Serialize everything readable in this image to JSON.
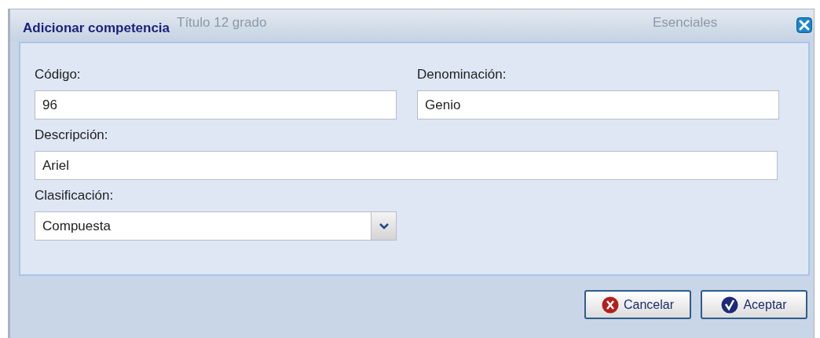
{
  "background_texts": [
    "Título 12 grado",
    "Esenciales"
  ],
  "dialog": {
    "title": "Adicionar competencia"
  },
  "fields": [
    {
      "kind": "text",
      "label": "Código:",
      "value": "96"
    },
    {
      "kind": "text",
      "label": "Denominación:",
      "value": "Genio"
    },
    {
      "kind": "long_text",
      "label": "Descripción:",
      "value": "Ariel"
    },
    {
      "kind": "select",
      "label": "Clasificación:",
      "value": "Compuesta"
    }
  ],
  "buttons": [
    {
      "kind": "cancel",
      "label": "Cancelar"
    },
    {
      "kind": "accept",
      "label": "Aceptar"
    }
  ]
}
